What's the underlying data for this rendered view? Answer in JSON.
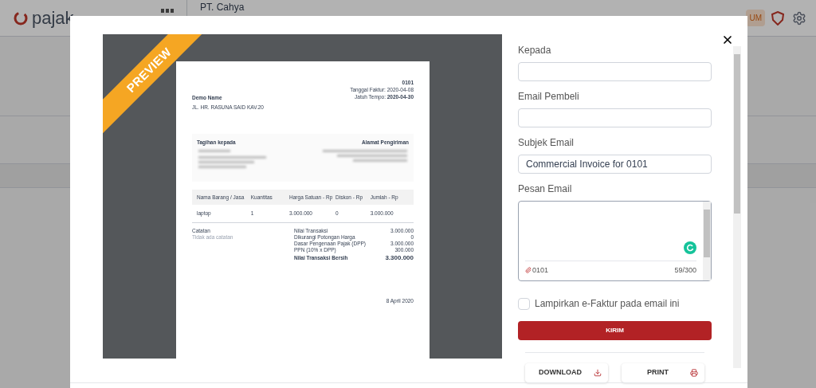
{
  "app_header": {
    "logo": "pajak",
    "company": "PT. Cahya",
    "badge": "UM"
  },
  "dialog": {
    "preview": {
      "ribbon": "PREVIEW",
      "invoice": {
        "number": "0101",
        "date_label": "Tanggal Faktur:",
        "date": "2020-04-08",
        "due_label": "Jatuh Tempo:",
        "due_date": "2020-04-30",
        "seller_name": "Demo Name",
        "seller_address": "JL. HR. RASUNA SAID KAV.20",
        "bill_to_label": "Tagihan kepada",
        "ship_to_label": "Alamat Pengiriman",
        "columns": [
          "Nama Barang / Jasa",
          "Kuantitas",
          "Harga Satuan - Rp",
          "Diskon - Rp",
          "Jumlah - Rp"
        ],
        "rows": [
          [
            "laptop",
            "1",
            "3.000.000",
            "0",
            "3.000.000"
          ]
        ],
        "notes_label": "Catatan",
        "notes": "Tidak ada catatan",
        "summary": [
          {
            "label": "Nilai Transaksi",
            "value": "3.000.000",
            "kind": "line"
          },
          {
            "label": "Dikurangi Potongan Harga",
            "value": "0",
            "kind": "line"
          },
          {
            "label": "Dasar Pengenaan Pajak (DPP)",
            "value": "3.000.000",
            "kind": "line"
          },
          {
            "label": "PPN (10% x DPP)",
            "value": "300.000",
            "kind": "line"
          },
          {
            "label": "Nilai Transaksi Bersih",
            "value": "3.300.000",
            "kind": "total"
          }
        ],
        "signed_date": "8 April 2020"
      }
    },
    "form": {
      "fields": [
        {
          "label": "Kepada"
        },
        {
          "label": "Email Pembeli"
        },
        {
          "label": "Subjek Email",
          "value": "Commercial Invoice for 0101"
        }
      ],
      "message": {
        "label": "Pesan Email",
        "attachment": "0101",
        "counter": "59/300"
      },
      "attach_checkbox": {
        "label": "Lampirkan e-Faktur pada email ini",
        "checked": false
      },
      "send_button": "KIRIM",
      "download_button": "DOWNLOAD",
      "print_button": "PRINT"
    }
  }
}
